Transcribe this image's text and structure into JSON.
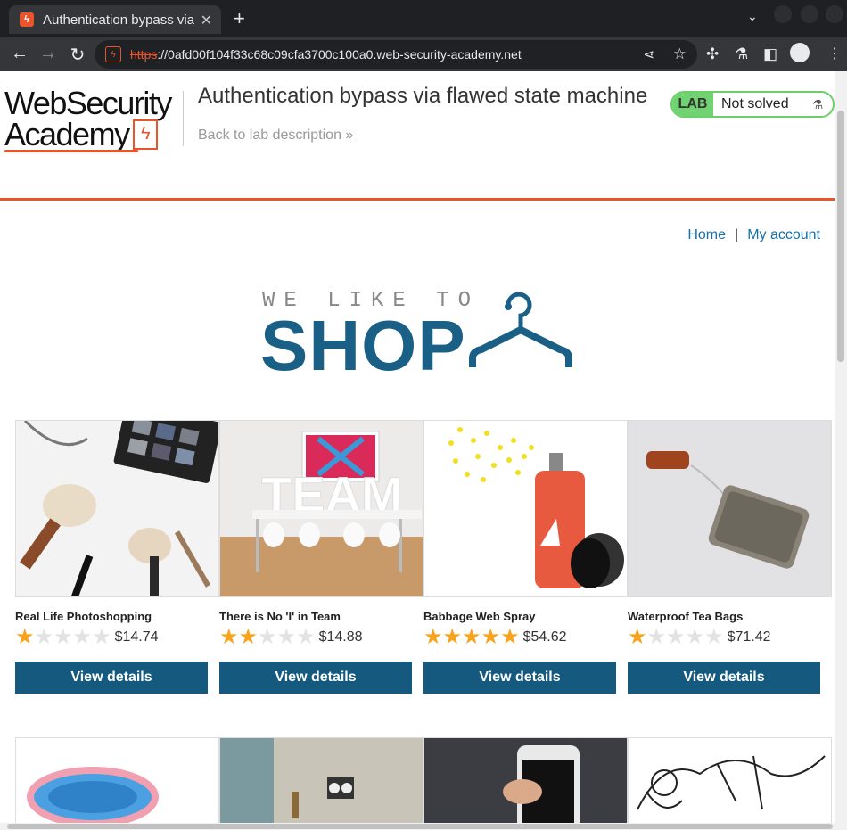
{
  "browser": {
    "tab_title": "Authentication bypass via flawed state machine",
    "url_protocol": "https",
    "url_host": "://0afd00f104f33c68c09cfa3700c100a0.web-security-academy.net"
  },
  "header": {
    "logo_line1": "WebSecurity",
    "logo_line2": "Academy",
    "lab_title": "Authentication bypass via flawed state machine",
    "back_link": "Back to lab description »",
    "badge_lab": "LAB",
    "badge_status": "Not solved"
  },
  "nav": {
    "home": "Home",
    "separator": "|",
    "my_account": "My account"
  },
  "hero": {
    "tagline": "WE LIKE TO",
    "title": "SHOP"
  },
  "products": [
    {
      "name": "Real Life Photoshopping",
      "rating": 1,
      "price": "$14.74",
      "button": "View details"
    },
    {
      "name": "There is No 'I' in Team",
      "rating": 2,
      "price": "$14.88",
      "button": "View details"
    },
    {
      "name": "Babbage Web Spray",
      "rating": 5,
      "price": "$54.62",
      "button": "View details"
    },
    {
      "name": "Waterproof Tea Bags",
      "rating": 1,
      "price": "$71.42",
      "button": "View details"
    }
  ],
  "colors": {
    "accent": "#e8552a",
    "brand_blue": "#155a7e",
    "link": "#1670a8",
    "lab_green": "#70d270",
    "star": "#f8a31b"
  }
}
